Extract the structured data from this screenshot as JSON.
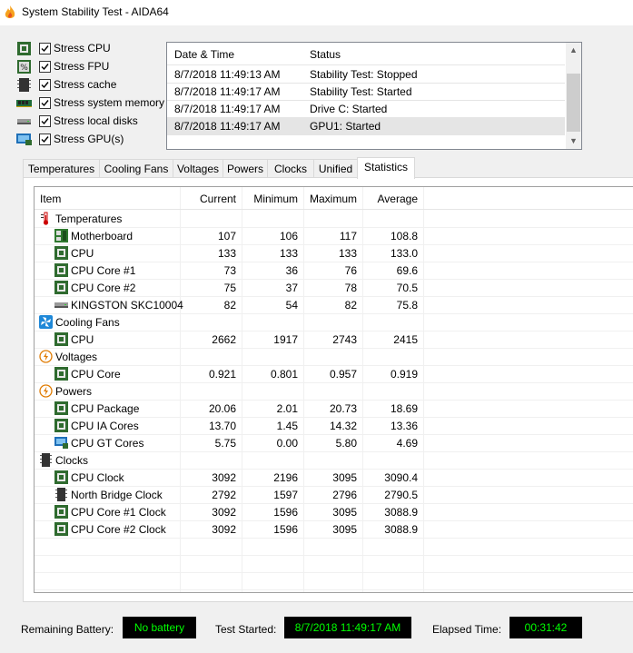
{
  "window": {
    "title": "System Stability Test - AIDA64",
    "icon": "aida64-flame-icon"
  },
  "stress_options": [
    {
      "label": "Stress CPU",
      "checked": true,
      "icon": "cpu-icon"
    },
    {
      "label": "Stress FPU",
      "checked": true,
      "icon": "fpu-icon"
    },
    {
      "label": "Stress cache",
      "checked": true,
      "icon": "cache-icon"
    },
    {
      "label": "Stress system memory",
      "checked": true,
      "icon": "memory-icon"
    },
    {
      "label": "Stress local disks",
      "checked": true,
      "icon": "disk-icon"
    },
    {
      "label": "Stress GPU(s)",
      "checked": true,
      "icon": "gpu-icon"
    }
  ],
  "log": {
    "headers": {
      "datetime": "Date & Time",
      "status": "Status"
    },
    "rows": [
      {
        "datetime": "8/7/2018 11:49:13 AM",
        "status": "Stability Test: Stopped"
      },
      {
        "datetime": "8/7/2018 11:49:17 AM",
        "status": "Stability Test: Started"
      },
      {
        "datetime": "8/7/2018 11:49:17 AM",
        "status": "Drive C: Started"
      },
      {
        "datetime": "8/7/2018 11:49:17 AM",
        "status": "GPU1: Started"
      }
    ]
  },
  "tabs": [
    "Temperatures",
    "Cooling Fans",
    "Voltages",
    "Powers",
    "Clocks",
    "Unified",
    "Statistics"
  ],
  "active_tab": "Statistics",
  "stats": {
    "headers": {
      "item": "Item",
      "current": "Current",
      "minimum": "Minimum",
      "maximum": "Maximum",
      "average": "Average"
    },
    "rows": [
      {
        "group": true,
        "item": "Temperatures",
        "icon": "thermometer-icon"
      },
      {
        "item": "Motherboard",
        "icon": "motherboard-icon",
        "current": "107",
        "minimum": "106",
        "maximum": "117",
        "average": "108.8"
      },
      {
        "item": "CPU",
        "icon": "cpu-icon",
        "current": "133",
        "minimum": "133",
        "maximum": "133",
        "average": "133.0"
      },
      {
        "item": "CPU Core #1",
        "icon": "cpu-icon",
        "current": "73",
        "minimum": "36",
        "maximum": "76",
        "average": "69.6"
      },
      {
        "item": "CPU Core #2",
        "icon": "cpu-icon",
        "current": "75",
        "minimum": "37",
        "maximum": "78",
        "average": "70.5"
      },
      {
        "item": "KINGSTON SKC10004",
        "icon": "disk-icon",
        "current": "82",
        "minimum": "54",
        "maximum": "82",
        "average": "75.8"
      },
      {
        "group": true,
        "item": "Cooling Fans",
        "icon": "fan-icon"
      },
      {
        "item": "CPU",
        "icon": "cpu-icon",
        "current": "2662",
        "minimum": "1917",
        "maximum": "2743",
        "average": "2415"
      },
      {
        "group": true,
        "item": "Voltages",
        "icon": "voltage-icon"
      },
      {
        "item": "CPU Core",
        "icon": "cpu-icon",
        "current": "0.921",
        "minimum": "0.801",
        "maximum": "0.957",
        "average": "0.919"
      },
      {
        "group": true,
        "item": "Powers",
        "icon": "power-icon"
      },
      {
        "item": "CPU Package",
        "icon": "cpu-icon",
        "current": "20.06",
        "minimum": "2.01",
        "maximum": "20.73",
        "average": "18.69"
      },
      {
        "item": "CPU IA Cores",
        "icon": "cpu-icon",
        "current": "13.70",
        "minimum": "1.45",
        "maximum": "14.32",
        "average": "13.36"
      },
      {
        "item": "CPU GT Cores",
        "icon": "gpu-icon",
        "current": "5.75",
        "minimum": "0.00",
        "maximum": "5.80",
        "average": "4.69"
      },
      {
        "group": true,
        "item": "Clocks",
        "icon": "clock-icon"
      },
      {
        "item": "CPU Clock",
        "icon": "cpu-icon",
        "current": "3092",
        "minimum": "2196",
        "maximum": "3095",
        "average": "3090.4"
      },
      {
        "item": "North Bridge Clock",
        "icon": "chip-icon",
        "current": "2792",
        "minimum": "1597",
        "maximum": "2796",
        "average": "2790.5"
      },
      {
        "item": "CPU Core #1 Clock",
        "icon": "cpu-icon",
        "current": "3092",
        "minimum": "1596",
        "maximum": "3095",
        "average": "3088.9"
      },
      {
        "item": "CPU Core #2 Clock",
        "icon": "cpu-icon",
        "current": "3092",
        "minimum": "1596",
        "maximum": "3095",
        "average": "3088.9"
      }
    ]
  },
  "status": {
    "battery_label": "Remaining Battery:",
    "battery_value": "No battery",
    "started_label": "Test Started:",
    "started_value": "8/7/2018 11:49:17 AM",
    "elapsed_label": "Elapsed Time:",
    "elapsed_value": "00:31:42"
  },
  "colors": {
    "display_bg": "#000000",
    "display_fg": "#00ff00",
    "selected_row": "#e5e5e5"
  }
}
